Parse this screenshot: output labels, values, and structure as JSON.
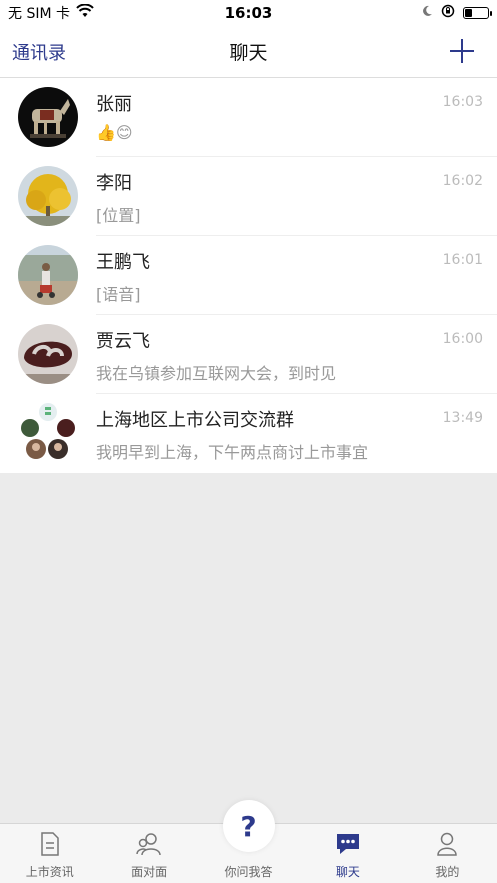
{
  "status_bar": {
    "carrier": "无 SIM 卡",
    "time": "16:03",
    "battery_level": 0.3
  },
  "nav": {
    "left_label": "通讯录",
    "title": "聊天",
    "right_icon": "plus-icon"
  },
  "chats": [
    {
      "name": "张丽",
      "time": "16:03",
      "preview": "👍😊",
      "avatar": "horse-statue"
    },
    {
      "name": "李阳",
      "time": "16:02",
      "preview": "[位置]",
      "avatar": "ginkgo-tree"
    },
    {
      "name": "王鹏飞",
      "time": "16:01",
      "preview": "[语音]",
      "avatar": "person-outdoors"
    },
    {
      "name": "贾云飞",
      "time": "16:00",
      "preview": "我在乌镇参加互联网大会，到时见",
      "avatar": "sculpture"
    },
    {
      "name": "上海地区上市公司交流群",
      "time": "13:49",
      "preview": "我明早到上海，下午两点商讨上市事宜",
      "avatar": "group-collage"
    }
  ],
  "tabs": [
    {
      "label": "上市资讯",
      "icon": "document-icon"
    },
    {
      "label": "面对面",
      "icon": "people-icon"
    },
    {
      "label": "你问我答",
      "icon": "question-icon"
    },
    {
      "label": "聊天",
      "icon": "chat-bubble-icon",
      "active": true
    },
    {
      "label": "我的",
      "icon": "user-icon"
    }
  ],
  "colors": {
    "accent": "#2d3a8c",
    "background": "#ebebeb",
    "time_gray": "#bbbbbb"
  }
}
